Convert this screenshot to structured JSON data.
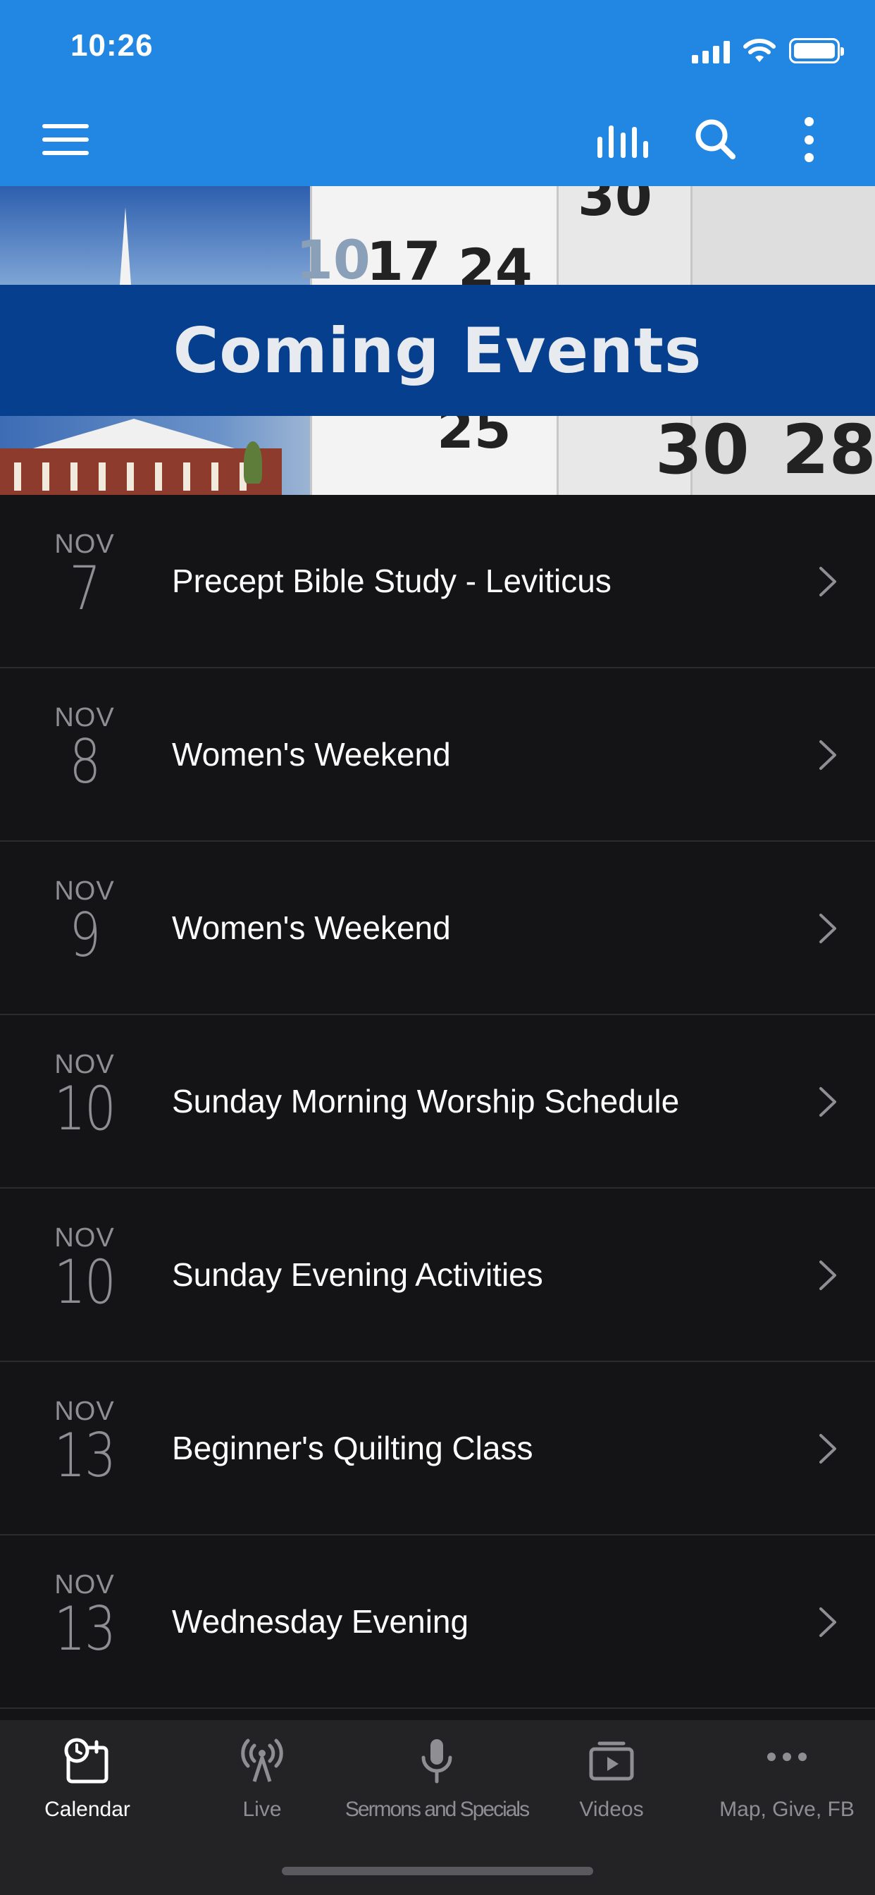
{
  "status_bar": {
    "time": "10:26"
  },
  "header": {
    "menu_icon": "hamburger-menu-icon",
    "audio_icon": "audio-bars-icon",
    "search_icon": "search-icon",
    "more_icon": "more-vertical-icon",
    "accent_color": "#2187e2"
  },
  "banner": {
    "title": "Coming Events",
    "calendar_numbers": [
      "10",
      "17",
      "24",
      "30",
      "25",
      "30",
      "28"
    ]
  },
  "events": [
    {
      "month": "NOV",
      "day": "7",
      "title": "Precept Bible Study - Leviticus"
    },
    {
      "month": "NOV",
      "day": "8",
      "title": "Women's Weekend"
    },
    {
      "month": "NOV",
      "day": "9",
      "title": "Women's Weekend"
    },
    {
      "month": "NOV",
      "day": "10",
      "title": "Sunday Morning Worship Schedule"
    },
    {
      "month": "NOV",
      "day": "10",
      "title": "Sunday Evening Activities"
    },
    {
      "month": "NOV",
      "day": "13",
      "title": "Beginner's Quilting Class"
    },
    {
      "month": "NOV",
      "day": "13",
      "title": "Wednesday Evening"
    }
  ],
  "tabbar": {
    "tabs": [
      {
        "label": "Calendar",
        "icon": "calendar-clock-icon",
        "active": true
      },
      {
        "label": "Live",
        "icon": "broadcast-icon",
        "active": false
      },
      {
        "label": "Sermons and Specials",
        "icon": "microphone-icon",
        "active": false
      },
      {
        "label": "Videos",
        "icon": "video-play-icon",
        "active": false
      },
      {
        "label": "Map, Give, FB",
        "icon": "more-horizontal-icon",
        "active": false
      }
    ]
  }
}
